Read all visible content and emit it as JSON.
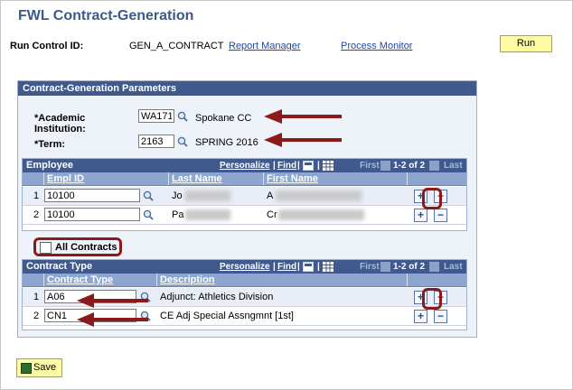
{
  "page": {
    "title": "FWL Contract-Generation"
  },
  "run_control": {
    "label": "Run Control ID:",
    "value": "GEN_A_CONTRACT",
    "report_manager": "Report Manager",
    "process_monitor": "Process Monitor",
    "run_label": "Run"
  },
  "params": {
    "header": "Contract-Generation Parameters",
    "institution": {
      "label": "*Academic Institution:",
      "value": "WA171",
      "description": "Spokane CC"
    },
    "term": {
      "label": "*Term:",
      "value": "2163",
      "description": "SPRING 2016"
    }
  },
  "employee_grid": {
    "title": "Employee",
    "personalize": "Personalize",
    "find": "Find",
    "first": "First",
    "range": "1-2 of 2",
    "last": "Last",
    "columns": [
      "Empl ID",
      "Last Name",
      "First Name"
    ],
    "rows": [
      {
        "num": "1",
        "empl_id": "10100",
        "last_name": "Jo",
        "first_name": "A"
      },
      {
        "num": "2",
        "empl_id": "10100",
        "last_name": "Pa",
        "first_name": "Cr"
      }
    ]
  },
  "all_contracts": {
    "label": "All Contracts",
    "checked": false
  },
  "contract_grid": {
    "title": "Contract Type",
    "personalize": "Personalize",
    "find": "Find",
    "first": "First",
    "range": "1-2 of 2",
    "last": "Last",
    "columns": [
      "Contract Type",
      "Description"
    ],
    "rows": [
      {
        "num": "1",
        "type": "A06",
        "description": "Adjunct: Athletics Division"
      },
      {
        "num": "2",
        "type": "CN1",
        "description": "CE Adj Special Assngmnt [1st]"
      }
    ]
  },
  "buttons": {
    "add": "+",
    "delete": "−",
    "save": "Save"
  },
  "colors": {
    "header_blue": "#415a8d",
    "highlight_red": "#8d1a1a",
    "button_yellow": "#fdfca4"
  }
}
